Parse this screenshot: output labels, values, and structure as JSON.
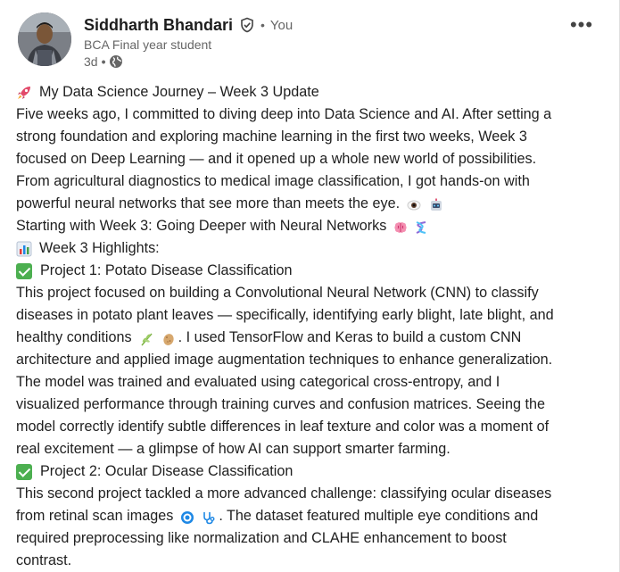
{
  "post": {
    "author": {
      "name": "Siddharth Bhandari",
      "connection": "You",
      "headline": "BCA Final year student",
      "time": "3d"
    },
    "lines": [
      "My Data Science Journey – Week 3 Update",
      "Five weeks ago, I committed to diving deep into Data Science and AI. After setting a",
      "strong foundation and exploring machine learning in the first two weeks, Week 3",
      "focused on Deep Learning — and it opened up a whole new world of possibilities.",
      "From agricultural diagnostics to medical image classification, I got hands-on with",
      "powerful neural networks that see more than meets the eye.",
      "Starting with Week 3: Going Deeper with Neural Networks",
      "Week 3 Highlights:",
      "Project 1: Potato Disease Classification",
      " This project focused on building a Convolutional Neural Network (CNN) to classify",
      "diseases in potato plant leaves — specifically, identifying early blight, late blight, and",
      "healthy conditions",
      ". I used TensorFlow and Keras to build a custom CNN",
      "architecture and applied image augmentation techniques to enhance generalization.",
      "The model was trained and evaluated using categorical cross-entropy, and I",
      "visualized performance through training curves and confusion matrices. Seeing the",
      "model correctly identify subtle differences in leaf texture and color was a moment of",
      "real excitement — a glimpse of how AI can support smarter farming.",
      "Project 2: Ocular Disease Classification",
      " This second project tackled a more advanced challenge: classifying ocular diseases",
      "from retinal scan images",
      ". The dataset featured multiple eye conditions and",
      "required preprocessing like normalization and CLAHE enhancement to boost",
      "contrast."
    ]
  },
  "icons": {
    "verified": "shield-check-icon",
    "visibility": "globe-icon",
    "more": "ellipsis-icon",
    "rocket": "rocket-icon",
    "eye": "eye-icon",
    "robot": "robot-icon",
    "brain": "brain-icon",
    "dna": "dna-icon",
    "chart": "bar-chart-icon",
    "check": "check-mark-icon",
    "herb": "herb-icon",
    "potato": "potato-icon",
    "target": "target-icon",
    "stethoscope": "stethoscope-icon"
  },
  "colors": {
    "text": "#1f1f1f",
    "muted": "#666666",
    "check_green": "#4caf50"
  }
}
